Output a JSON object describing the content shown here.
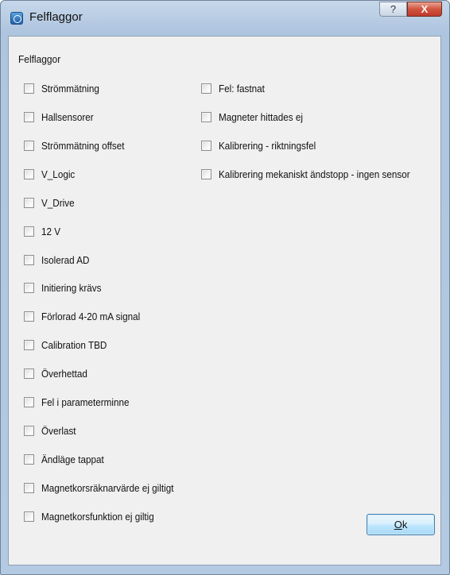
{
  "window": {
    "title": "Felflaggor",
    "help_glyph": "?",
    "close_glyph": "X"
  },
  "group": {
    "label": "Felflaggor"
  },
  "left_flags": [
    {
      "label": "Strömmätning",
      "checked": false
    },
    {
      "label": "Hallsensorer",
      "checked": false
    },
    {
      "label": "Strömmätning offset",
      "checked": false
    },
    {
      "label": "V_Logic",
      "checked": false
    },
    {
      "label": "V_Drive",
      "checked": false
    },
    {
      "label": "12 V",
      "checked": false
    },
    {
      "label": "Isolerad AD",
      "checked": false
    },
    {
      "label": "Initiering krävs",
      "checked": false
    },
    {
      "label": "Förlorad 4-20 mA signal",
      "checked": false
    },
    {
      "label": "Calibration TBD",
      "checked": false
    },
    {
      "label": "Överhettad",
      "checked": false
    },
    {
      "label": "Fel i parameterminne",
      "checked": false
    },
    {
      "label": "Överlast",
      "checked": false
    },
    {
      "label": "Ändläge tappat",
      "checked": false
    },
    {
      "label": "Magnetkorsräknarvärde ej giltigt",
      "checked": false
    },
    {
      "label": "Magnetkorsfunktion ej giltig",
      "checked": false
    }
  ],
  "right_flags": [
    {
      "label": "Fel: fastnat",
      "checked": false
    },
    {
      "label": "Magneter hittades ej",
      "checked": false
    },
    {
      "label": "Kalibrering - riktningsfel",
      "checked": false
    },
    {
      "label": "Kalibrering mekaniskt ändstopp - ingen sensor",
      "checked": false
    }
  ],
  "ok_button": {
    "mnemonic": "O",
    "rest": "k"
  },
  "colors": {
    "title_gradient": "#b4cae3",
    "ok_button_border": "#3c7fb1",
    "close_button": "#c0392b"
  }
}
